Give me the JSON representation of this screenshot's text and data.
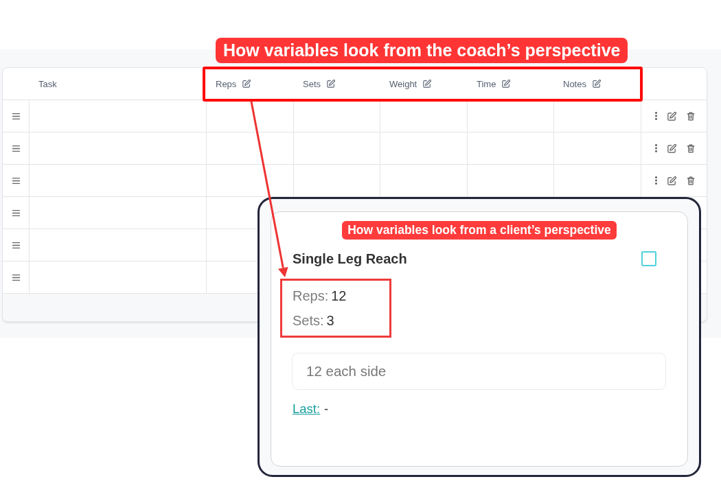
{
  "coach_view": {
    "callout": "How variables look from the coach’s perspective",
    "table": {
      "columns": [
        {
          "label": "Task",
          "editable": false
        },
        {
          "label": "Reps",
          "editable": true
        },
        {
          "label": "Sets",
          "editable": true
        },
        {
          "label": "Weight",
          "editable": true
        },
        {
          "label": "Time",
          "editable": true
        },
        {
          "label": "Notes",
          "editable": true
        }
      ],
      "rows": [
        {
          "actions": true
        },
        {
          "actions": true
        },
        {
          "actions": true
        },
        {},
        {},
        {}
      ]
    }
  },
  "client_view": {
    "callout": "How variables look from a client’s perspective",
    "title": "Single Leg Reach",
    "checked": false,
    "variables": [
      {
        "label": "Reps:",
        "value": "12"
      },
      {
        "label": "Sets:",
        "value": "3"
      }
    ],
    "notes": "12 each side",
    "last": {
      "label": "Last:",
      "value": "-"
    }
  }
}
